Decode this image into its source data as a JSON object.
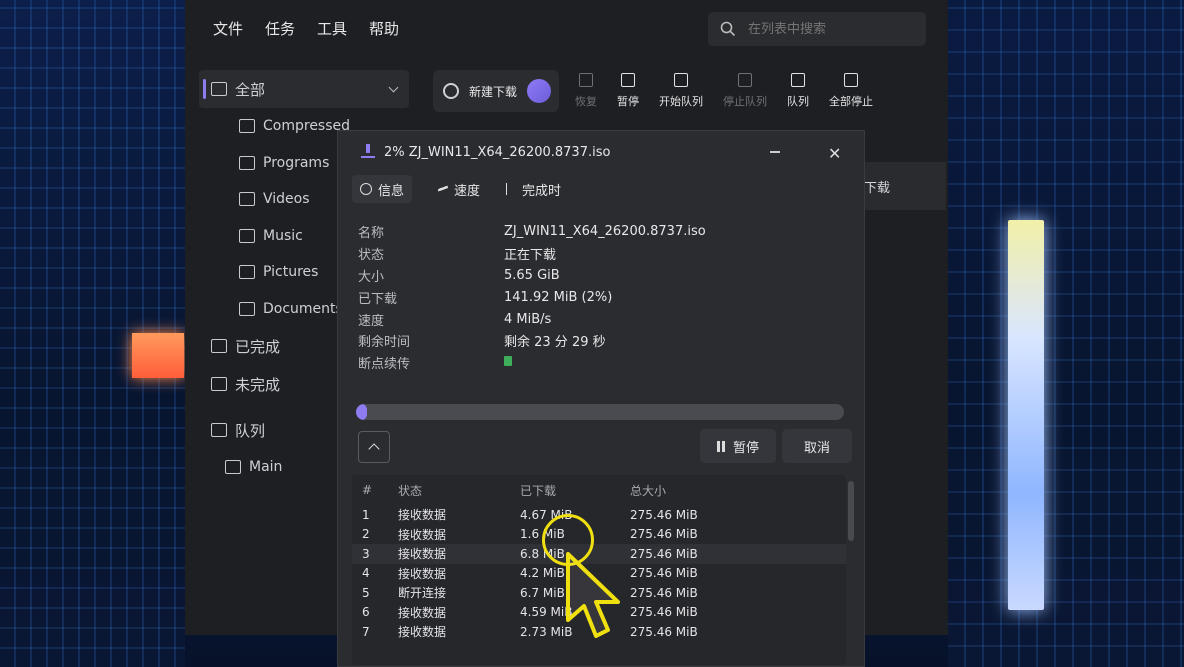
{
  "menu": {
    "file": "文件",
    "task": "任务",
    "tools": "工具",
    "help": "帮助"
  },
  "search": {
    "placeholder": "在列表中搜索"
  },
  "sidebar": {
    "all": "全部",
    "items": [
      "Compressed",
      "Programs",
      "Videos",
      "Music",
      "Pictures",
      "Documents"
    ],
    "completed": "已完成",
    "incomplete": "未完成",
    "queue": "队列",
    "queue_main": "Main"
  },
  "toolbar": {
    "new_download": "新建下载",
    "resume": "恢复",
    "pause": "暂停",
    "start_queue": "开始队列",
    "stop_queue": "停止队列",
    "queue": "队列",
    "stop_all": "全部停止"
  },
  "behind_text": "下载",
  "dialog": {
    "title": "2% ZJ_WIN11_X64_26200.8737.iso",
    "tabs": {
      "info": "信息",
      "speed": "速度",
      "on_complete": "完成时"
    },
    "info": [
      {
        "k": "名称",
        "v": "ZJ_WIN11_X64_26200.8737.iso"
      },
      {
        "k": "状态",
        "v": "正在下载"
      },
      {
        "k": "大小",
        "v": "5.65 GiB"
      },
      {
        "k": "已下载",
        "v": "141.92 MiB (2%)"
      },
      {
        "k": "速度",
        "v": "4 MiB/s"
      },
      {
        "k": "剩余时间",
        "v": "剩余 23 分 29 秒"
      },
      {
        "k": "断点续传",
        "v": ""
      }
    ],
    "progress": 0.02,
    "pause": "暂停",
    "cancel": "取消",
    "table": {
      "headers": [
        "#",
        "状态",
        "已下载",
        "总大小"
      ],
      "rows": [
        [
          "1",
          "接收数据",
          "4.67 MiB",
          "275.46 MiB"
        ],
        [
          "2",
          "接收数据",
          "1.6 MiB",
          "275.46 MiB"
        ],
        [
          "3",
          "接收数据",
          "6.8 MiB",
          "275.46 MiB"
        ],
        [
          "4",
          "接收数据",
          "4.2 MiB",
          "275.46 MiB"
        ],
        [
          "5",
          "断开连接",
          "6.7 MiB",
          "275.46 MiB"
        ],
        [
          "6",
          "接收数据",
          "4.59 MiB",
          "275.46 MiB"
        ],
        [
          "7",
          "接收数据",
          "2.73 MiB",
          "275.46 MiB"
        ]
      ]
    }
  },
  "colors": {
    "accent": "#8e7cf0",
    "bg": "#1e1f22",
    "panel": "#2b2c30",
    "resume_ok": "#3fae5a"
  }
}
